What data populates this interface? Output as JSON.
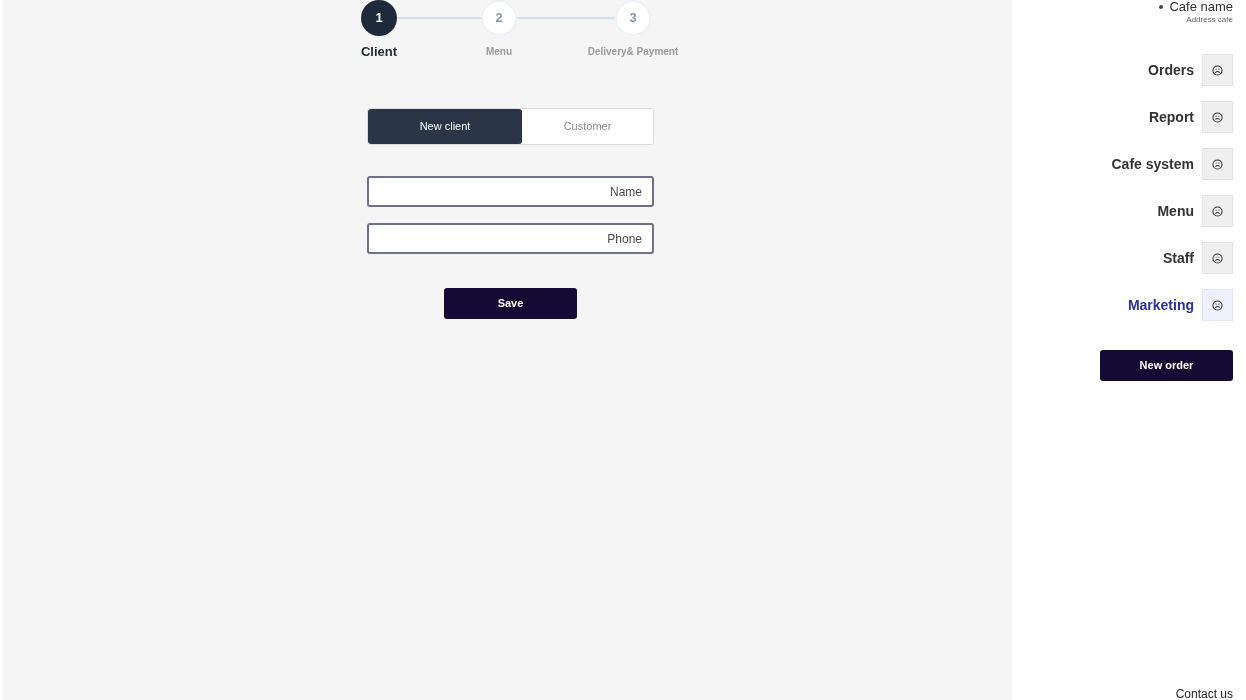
{
  "stepper": {
    "steps": [
      {
        "number": "1",
        "label": "Client",
        "selected": true
      },
      {
        "number": "2",
        "label": "Menu",
        "selected": false
      },
      {
        "number": "3",
        "label": "Delivery& Payment",
        "selected": false
      }
    ]
  },
  "client_form": {
    "toggle": [
      {
        "label": "New client",
        "selected": true
      },
      {
        "label": "Customer",
        "selected": false
      }
    ],
    "fields": [
      {
        "placeholder": "Name"
      },
      {
        "placeholder": "Phone"
      }
    ],
    "save_button": "Save"
  },
  "sidebar": {
    "cafe_name": "Cafe name",
    "cafe_address": "Address cafe",
    "items": [
      {
        "label": "Orders",
        "selected": false
      },
      {
        "label": "Report",
        "selected": false
      },
      {
        "label": "Cafe system",
        "selected": false
      },
      {
        "label": "Menu",
        "selected": false
      },
      {
        "label": "Staff",
        "selected": false
      },
      {
        "label": "Marketing",
        "selected": true
      }
    ],
    "new_order_button": "New order",
    "footer_link": "Contact us"
  }
}
